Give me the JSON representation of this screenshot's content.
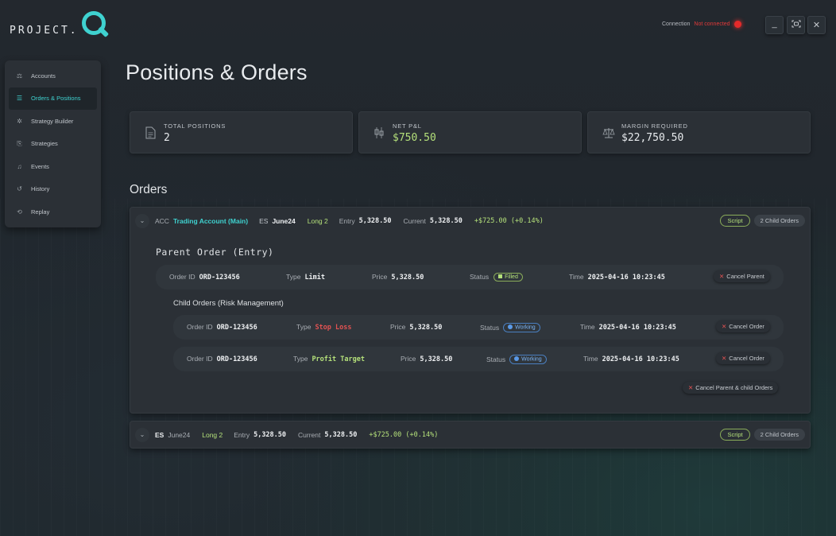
{
  "brand": {
    "text": "PROJECT.",
    "mark": "Q"
  },
  "connection": {
    "label": "Connection",
    "status": "Not connected",
    "status_color": "#e42a2a"
  },
  "window_controls": [
    {
      "name": "minimize",
      "glyph": "_"
    },
    {
      "name": "screenshot",
      "glyph": "[◎]"
    },
    {
      "name": "close",
      "glyph": "✕"
    }
  ],
  "sidebar": {
    "items": [
      {
        "label": "Accounts",
        "icon": "scale-icon"
      },
      {
        "label": "Orders & Positions",
        "icon": "orders-icon",
        "active": true
      },
      {
        "label": "Strategy Builder",
        "icon": "builder-icon"
      },
      {
        "label": "Strategies",
        "icon": "strategies-icon"
      },
      {
        "label": "Events",
        "icon": "bell-icon"
      },
      {
        "label": "History",
        "icon": "history-icon"
      },
      {
        "label": "Replay",
        "icon": "replay-icon"
      }
    ]
  },
  "page": {
    "title": "Positions & Orders"
  },
  "stats": [
    {
      "label": "TOTAL POSITIONS",
      "value": "2",
      "icon": "document-icon"
    },
    {
      "label": "NET P&L",
      "value": "$750.50",
      "icon": "candlestick-icon"
    },
    {
      "label": "MARGIN REQUIRED",
      "value": "$22,750.50",
      "icon": "balance-scale-icon"
    }
  ],
  "orders_section": {
    "title": "Orders"
  },
  "orders": [
    {
      "acc_label": "ACC",
      "account": "Trading Account (Main)",
      "symbol": "ES",
      "contract": "June24",
      "side": "Long 2",
      "entry_label": "Entry",
      "entry": "5,328.50",
      "current_label": "Current",
      "current": "5,328.50",
      "pnl": "+$725.00 (+0.14%)",
      "script_label": "Script",
      "child_count_label": "2 Child Orders",
      "parent": {
        "title": "Parent Order (Entry)",
        "order_id_label": "Order ID",
        "order_id": "ORD-123456",
        "type_label": "Type",
        "type": "Limit",
        "price_label": "Price",
        "price": "5,328.50",
        "status_label": "Status",
        "status": "Filled",
        "time_label": "Time",
        "time": "2025-04-16 10:23:45",
        "cancel_label": "Cancel Parent"
      },
      "child_title": "Child Orders (Risk Management)",
      "children": [
        {
          "order_id_label": "Order ID",
          "order_id": "ORD-123456",
          "type_label": "Type",
          "type": "Stop Loss",
          "price_label": "Price",
          "price": "5,328.50",
          "status_label": "Status",
          "status": "Working",
          "time_label": "Time",
          "time": "2025-04-16 10:23:45",
          "cancel_label": "Cancel Order"
        },
        {
          "order_id_label": "Order ID",
          "order_id": "ORD-123456",
          "type_label": "Type",
          "type": "Profit Target",
          "price_label": "Price",
          "price": "5,328.50",
          "status_label": "Status",
          "status": "Working",
          "time_label": "Time",
          "time": "2025-04-16 10:23:45",
          "cancel_label": "Cancel Order"
        }
      ],
      "cancel_all_label": "Cancel Parent & child Orders"
    },
    {
      "symbol": "ES",
      "contract": "June24",
      "side": "Long 2",
      "entry_label": "Entry",
      "entry": "5,328.50",
      "current_label": "Current",
      "current": "5,328.50",
      "pnl": "+$725.00 (+0.14%)",
      "script_label": "Script",
      "child_count_label": "2 Child Orders"
    }
  ],
  "colors": {
    "accent": "#3fd2d0",
    "positive": "#b4e07a",
    "negative": "#e25252",
    "working": "#5b9ae8"
  }
}
